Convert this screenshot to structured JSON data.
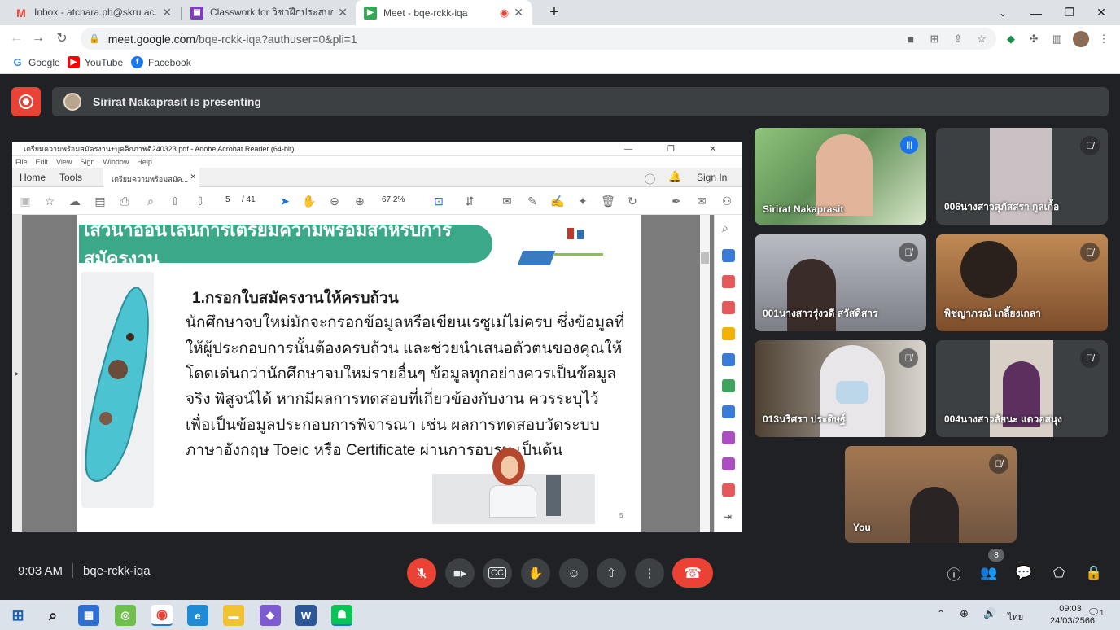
{
  "browser": {
    "tabs": [
      {
        "title": "Inbox - atchara.ph@skru.ac.th - ส",
        "icon": "gmail-icon",
        "color": "#ea4335"
      },
      {
        "title": "Classwork for วิชาฝึกประสบการณ์วิช",
        "icon": "classroom-icon",
        "color": "#7b3fb8"
      },
      {
        "title": "Meet - bqe-rckk-iqa",
        "icon": "meet-icon",
        "color": "#34a853"
      }
    ],
    "url_host": "meet.google.com",
    "url_path": "/bqe-rckk-iqa?authuser=0&pli=1",
    "bookmarks": [
      {
        "label": "Google",
        "color": "#4285f4"
      },
      {
        "label": "YouTube",
        "color": "#ff0000"
      },
      {
        "label": "Facebook",
        "color": "#1877f2"
      }
    ]
  },
  "meet": {
    "presenting_text": "Sirirat Nakaprasit is presenting",
    "meeting_time": "9:03 AM",
    "meeting_code": "bqe-rckk-iqa",
    "participant_count": "8",
    "tiles": [
      {
        "name": "Sirirat Nakaprasit",
        "speaking": true,
        "muted": false,
        "bg": "#5f8f56"
      },
      {
        "name": "006นางสาวสุภัสสรา กูลเกื้อ",
        "speaking": false,
        "muted": true,
        "bg": "#3a3a3a"
      },
      {
        "name": "001นางสาวรุ่งวดี สวัสดิสาร",
        "speaking": false,
        "muted": true,
        "bg": "#8a8d93"
      },
      {
        "name": "พิชญาภรณ์ เกลี้ยงเกลา",
        "speaking": false,
        "muted": true,
        "bg": "#a06c3e"
      },
      {
        "name": "013นริศรา ประดิษฐ์",
        "speaking": false,
        "muted": true,
        "bg": "#6b5a48"
      },
      {
        "name": "004นางสาวลัยนะ แดวอสนุง",
        "speaking": false,
        "muted": true,
        "bg": "#4b4545"
      },
      {
        "name": "You",
        "speaking": false,
        "muted": true,
        "bg": "#8e6a4a"
      }
    ]
  },
  "acrobat": {
    "window_title": "เตรียมความพร้อมสมัครงาน+บุคลิกภาพดี240323.pdf - Adobe Acrobat Reader (64-bit)",
    "menu": [
      "File",
      "Edit",
      "View",
      "Sign",
      "Window",
      "Help"
    ],
    "home_tab": "Home",
    "tools_tab": "Tools",
    "doc_tab": "เตรียมความพร้อมสมัค...",
    "sign_in": "Sign In",
    "page_current": "5",
    "page_total": "/ 41",
    "zoom": "67.2%",
    "slide": {
      "banner": "เสวนาออนไลน์การเตรียมความพร้อมสำหรับการสมัครงาน",
      "heading": "1.กรอกใบสมัครงานให้ครบถ้วน",
      "lines": [
        "นักศึกษาจบใหม่มักจะกรอกข้อมูลหรือเขียนเรซูเม่ไม่ครบ ซึ่งข้อมูลที่",
        "ให้ผู้ประกอบการนั้นต้องครบถ้วน และช่วยนำเสนอตัวตนของคุณให้",
        "โดดเด่นกว่านักศึกษาจบใหม่รายอื่นๆ ข้อมูลทุกอย่างควรเป็นข้อมูล",
        "จริง พิสูจน์ได้ หากมีผลการทดสอบที่เกี่ยวข้องกับงาน ควรระบุไว้",
        "เพื่อเป็นข้อมูลประกอบการพิจารณา เช่น ผลการทดสอบวัดระบบ",
        "ภาษาอังกฤษ Toeic หรือ Certificate ผ่านการอบรม เป็นต้น"
      ],
      "page_num": "5"
    }
  },
  "taskbar": {
    "time": "09:03",
    "date": "24/03/2566",
    "lang": "ไทย",
    "notif_count": "1"
  }
}
